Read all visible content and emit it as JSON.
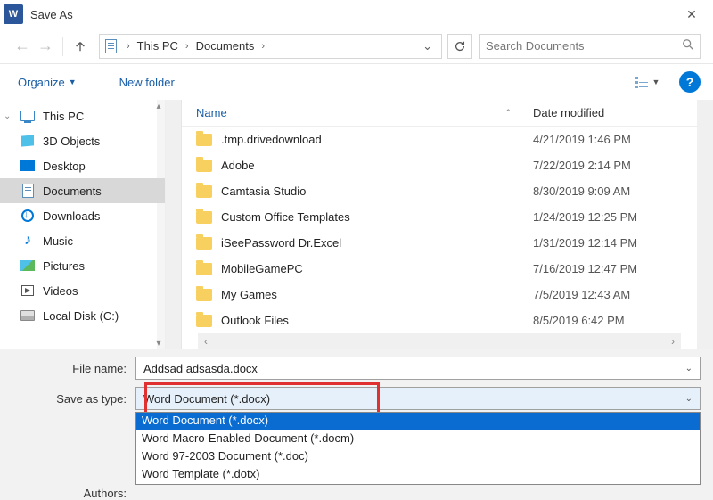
{
  "title": "Save As",
  "breadcrumb": {
    "root": "This PC",
    "folder": "Documents"
  },
  "search_placeholder": "Search Documents",
  "toolbar": {
    "organize": "Organize",
    "new_folder": "New folder"
  },
  "help_label": "?",
  "tree": {
    "items": [
      {
        "label": "This PC",
        "icon": "monitor",
        "expandable": true
      },
      {
        "label": "3D Objects",
        "icon": "cube"
      },
      {
        "label": "Desktop",
        "icon": "desktop"
      },
      {
        "label": "Documents",
        "icon": "doc",
        "selected": true
      },
      {
        "label": "Downloads",
        "icon": "down"
      },
      {
        "label": "Music",
        "icon": "music"
      },
      {
        "label": "Pictures",
        "icon": "pic"
      },
      {
        "label": "Videos",
        "icon": "vid"
      },
      {
        "label": "Local Disk (C:)",
        "icon": "disk"
      }
    ]
  },
  "columns": {
    "name": "Name",
    "date": "Date modified"
  },
  "files": [
    {
      "name": ".tmp.drivedownload",
      "date": "4/21/2019 1:46 PM"
    },
    {
      "name": "Adobe",
      "date": "7/22/2019 2:14 PM"
    },
    {
      "name": "Camtasia Studio",
      "date": "8/30/2019 9:09 AM"
    },
    {
      "name": "Custom Office Templates",
      "date": "1/24/2019 12:25 PM"
    },
    {
      "name": "iSeePassword Dr.Excel",
      "date": "1/31/2019 12:14 PM"
    },
    {
      "name": "MobileGamePC",
      "date": "7/16/2019 12:47 PM"
    },
    {
      "name": "My Games",
      "date": "7/5/2019 12:43 AM"
    },
    {
      "name": "Outlook Files",
      "date": "8/5/2019 6:42 PM"
    }
  ],
  "form": {
    "file_name_label": "File name:",
    "file_name_value": "Addsad adsasda.docx",
    "save_type_label": "Save as type:",
    "save_type_value": "Word Document (*.docx)",
    "authors_label": "Authors:"
  },
  "type_options": [
    "Word Document (*.docx)",
    "Word Macro-Enabled Document (*.docm)",
    "Word 97-2003 Document (*.doc)",
    "Word Template (*.dotx)"
  ]
}
